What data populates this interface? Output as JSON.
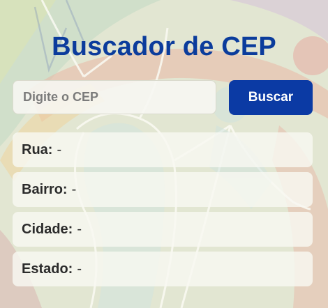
{
  "page": {
    "title": "Buscador de CEP"
  },
  "search": {
    "placeholder": "Digite o CEP",
    "value": "",
    "button_label": "Buscar"
  },
  "results": [
    {
      "label": "Rua:",
      "value": "-"
    },
    {
      "label": "Bairro:",
      "value": "-"
    },
    {
      "label": "Cidade:",
      "value": "-"
    },
    {
      "label": "Estado:",
      "value": "-"
    }
  ],
  "colors": {
    "title": "#0b3c9c",
    "button": "#0b3aa4",
    "button_text": "#ffffff",
    "background": "#e4e6d3"
  }
}
